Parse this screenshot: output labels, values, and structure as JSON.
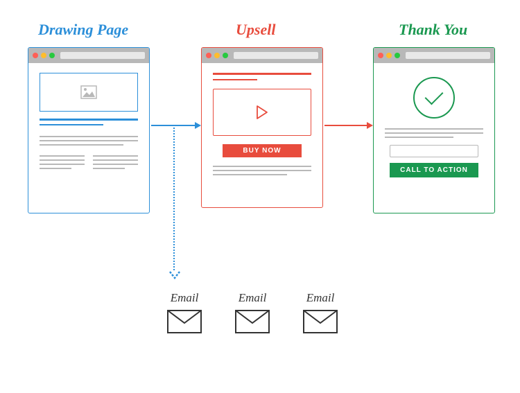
{
  "titles": {
    "drawing": "Drawing Page",
    "upsell": "Upsell",
    "thankyou": "Thank You"
  },
  "upsell": {
    "buy_button": "BUY NOW"
  },
  "thankyou": {
    "cta_button": "CALL TO ACTION"
  },
  "emails": {
    "label": "Email"
  },
  "colors": {
    "blue": "#2c8fd9",
    "red": "#e84c3d",
    "green": "#1a9850",
    "grey": "#b8b8b8"
  }
}
